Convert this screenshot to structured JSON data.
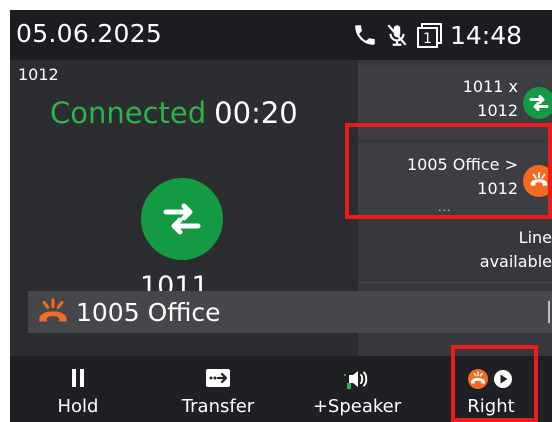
{
  "status_bar": {
    "date": "05.06.2025",
    "time": "14:48",
    "icons": [
      "phone-icon",
      "mic-muted-icon",
      "line-1-icon"
    ]
  },
  "call": {
    "line_number": "1012",
    "status": "Connected",
    "timer": "00:20",
    "remote_number": "1011"
  },
  "conference_list": [
    {
      "line1": "1011 x",
      "line2": "1012",
      "icon": "swap-icon",
      "color": "#149a43"
    },
    {
      "line1": "1005 Office >",
      "line2": "1012",
      "more": "...",
      "icon": "hold-phone-icon",
      "color": "#f26b21"
    }
  ],
  "line_status": {
    "line1": "Line",
    "line2": "available"
  },
  "held_call": {
    "label": "1005 Office",
    "icon": "hold-phone-icon",
    "color": "#f26b21"
  },
  "softkeys": [
    {
      "label": "Hold",
      "icon": "pause-icon"
    },
    {
      "label": "Transfer",
      "icon": "transfer-icon"
    },
    {
      "label": "+Speaker",
      "icon": "speaker-icon"
    },
    {
      "label": "Right",
      "icon": "hold-play-icon"
    }
  ],
  "colors": {
    "accent_green": "#2fb24c",
    "avatar_green": "#149a43",
    "hold_orange": "#f26b21",
    "highlight_red": "#ea1b1b"
  }
}
